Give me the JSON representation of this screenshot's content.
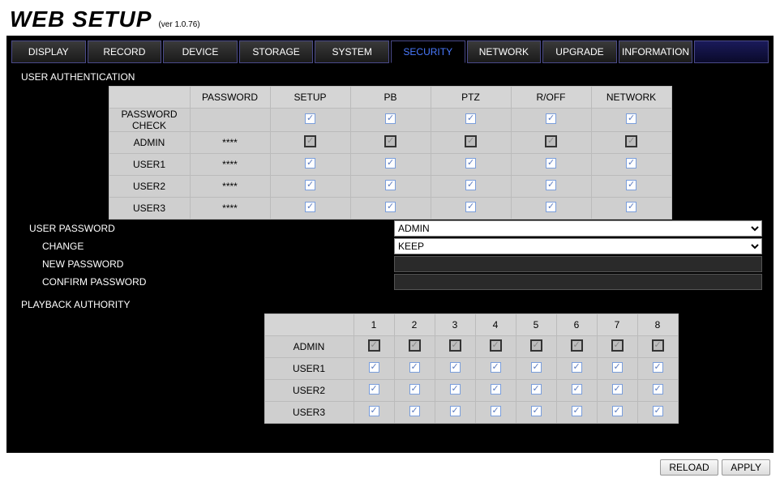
{
  "title": "WEB SETUP",
  "version": "(ver 1.0.76)",
  "tabs": [
    "DISPLAY",
    "RECORD",
    "DEVICE",
    "STORAGE",
    "SYSTEM",
    "SECURITY",
    "NETWORK",
    "UPGRADE",
    "INFORMATION"
  ],
  "activeTab": "SECURITY",
  "sections": {
    "userAuth": "USER AUTHENTICATION",
    "userPwd": "USER PASSWORD",
    "change": "CHANGE",
    "newPwd": "NEW PASSWORD",
    "confirmPwd": "CONFIRM PASSWORD",
    "playback": "PLAYBACK AUTHORITY"
  },
  "authCols": [
    "PASSWORD",
    "SETUP",
    "PB",
    "PTZ",
    "R/OFF",
    "NETWORK"
  ],
  "authRows": [
    {
      "label": "PASSWORD CHECK",
      "pwd": "",
      "locked": false,
      "checks": [
        true,
        true,
        true,
        true,
        true
      ]
    },
    {
      "label": "ADMIN",
      "pwd": "****",
      "locked": true,
      "checks": [
        true,
        true,
        true,
        true,
        true
      ]
    },
    {
      "label": "USER1",
      "pwd": "****",
      "locked": false,
      "checks": [
        true,
        true,
        true,
        true,
        true
      ]
    },
    {
      "label": "USER2",
      "pwd": "****",
      "locked": false,
      "checks": [
        true,
        true,
        true,
        true,
        true
      ]
    },
    {
      "label": "USER3",
      "pwd": "****",
      "locked": false,
      "checks": [
        true,
        true,
        true,
        true,
        true
      ]
    }
  ],
  "userPwdSelect": "ADMIN",
  "changeSelect": "KEEP",
  "pbCols": [
    "1",
    "2",
    "3",
    "4",
    "5",
    "6",
    "7",
    "8"
  ],
  "pbRows": [
    {
      "label": "ADMIN",
      "locked": true,
      "checks": [
        true,
        true,
        true,
        true,
        true,
        true,
        true,
        true
      ]
    },
    {
      "label": "USER1",
      "locked": false,
      "checks": [
        true,
        true,
        true,
        true,
        true,
        true,
        true,
        true
      ]
    },
    {
      "label": "USER2",
      "locked": false,
      "checks": [
        true,
        true,
        true,
        true,
        true,
        true,
        true,
        true
      ]
    },
    {
      "label": "USER3",
      "locked": false,
      "checks": [
        true,
        true,
        true,
        true,
        true,
        true,
        true,
        true
      ]
    }
  ],
  "buttons": {
    "reload": "RELOAD",
    "apply": "APPLY"
  }
}
